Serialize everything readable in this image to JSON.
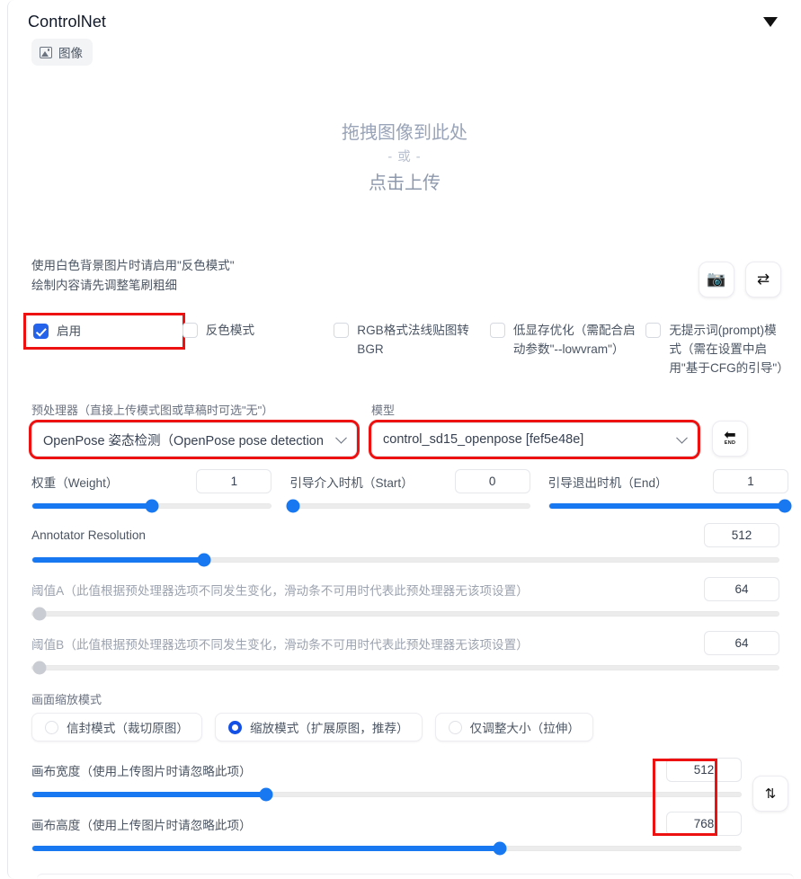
{
  "header": {
    "title": "ControlNet",
    "collapse_icon": "chevron-down-icon"
  },
  "tabs": [
    {
      "label": "图像",
      "icon": "image-icon"
    }
  ],
  "dropzone": {
    "main": "拖拽图像到此处",
    "or": "- 或 -",
    "click": "点击上传"
  },
  "hints": {
    "line1": "使用白色背景图片时请启用\"反色模式\"",
    "line2": "绘制内容请先调整笔刷粗细"
  },
  "icon_buttons": [
    {
      "name": "camera-button",
      "glyph": "📷"
    },
    {
      "name": "swap-horizontal-button",
      "glyph": "⇄"
    }
  ],
  "checkboxes": [
    {
      "label": "启用",
      "checked": true,
      "highlighted": true
    },
    {
      "label": "反色模式",
      "checked": false,
      "highlighted": false
    },
    {
      "label": "RGB格式法线贴图转BGR",
      "checked": false,
      "highlighted": false
    },
    {
      "label": "低显存优化（需配合启动参数\"--lowvram\"）",
      "checked": false,
      "highlighted": false
    },
    {
      "label": "无提示词(prompt)模式（需在设置中启用\"基于CFG的引导\"）",
      "checked": false,
      "highlighted": false
    }
  ],
  "preprocessor": {
    "label": "预处理器（直接上传模式图或草稿时可选\"无\"）",
    "value": "OpenPose 姿态检测（OpenPose pose detection",
    "highlighted": true
  },
  "model": {
    "label": "模型",
    "value": "control_sd15_openpose [fef5e48e]",
    "highlighted": true
  },
  "refresh_button": {
    "name": "refresh-models-button",
    "arrow": "⬅",
    "sub": "END"
  },
  "sliders_row1": [
    {
      "label": "权重（Weight）",
      "value": "1",
      "percent": 50,
      "disabled": false
    },
    {
      "label": "引导介入时机（Start）",
      "value": "0",
      "percent": 0,
      "disabled": false
    },
    {
      "label": "引导退出时机（End）",
      "value": "1",
      "percent": 100,
      "disabled": false
    }
  ],
  "annotator": {
    "label": "Annotator Resolution",
    "value": "512",
    "percent": 23,
    "disabled": false
  },
  "threshold_a": {
    "label": "阈值A（此值根据预处理器选项不同发生变化，滑动条不可用时代表此预处理器无该项设置）",
    "value": "64",
    "percent": 0,
    "disabled": true
  },
  "threshold_b": {
    "label": "阈值B（此值根据预处理器选项不同发生变化，滑动条不可用时代表此预处理器无该项设置）",
    "value": "64",
    "percent": 0,
    "disabled": true
  },
  "resize_mode": {
    "title": "画面缩放模式",
    "options": [
      {
        "label": "信封模式（裁切原图）",
        "selected": false
      },
      {
        "label": "缩放模式（扩展原图，推荐）",
        "selected": true
      },
      {
        "label": "仅调整大小（拉伸）",
        "selected": false
      }
    ]
  },
  "canvas_width": {
    "label": "画布宽度（使用上传图片时请忽略此项）",
    "value": "512",
    "percent": 33,
    "disabled": false
  },
  "canvas_height": {
    "label": "画布高度（使用上传图片时请忽略此项）",
    "value": "768",
    "percent": 66,
    "disabled": false
  },
  "swap_size_button": {
    "name": "swap-vertical-button",
    "glyph": "⇅"
  },
  "colors": {
    "accent_blue": "#1778f2",
    "checkbox_blue": "#2563eb",
    "radio_blue": "#1450e6",
    "highlight_red": "#ee1111",
    "track_gray": "#ececec"
  }
}
